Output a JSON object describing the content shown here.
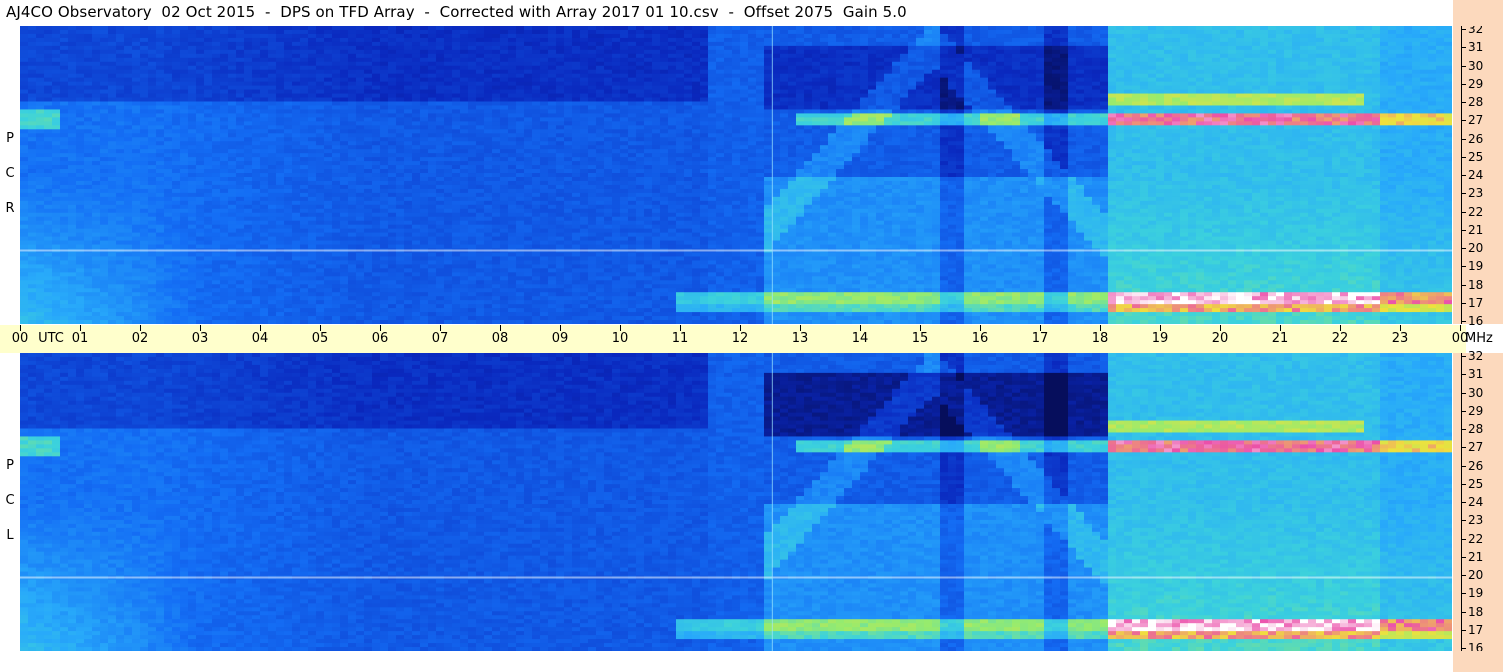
{
  "title": "AJ4CO Observatory  02 Oct 2015  -  DPS on TFD Array  -  Corrected with Array 2017 01 10.csv  -  Offset 2075  Gain 5.0",
  "panels": {
    "top": {
      "label_letters": [
        "R",
        "C",
        "P"
      ]
    },
    "bottom": {
      "label_letters": [
        "L",
        "C",
        "P"
      ]
    }
  },
  "time_axis": {
    "labels": [
      "00",
      "01",
      "02",
      "03",
      "04",
      "05",
      "06",
      "07",
      "08",
      "09",
      "10",
      "11",
      "12",
      "13",
      "14",
      "15",
      "16",
      "17",
      "18",
      "19",
      "20",
      "21",
      "22",
      "23",
      "00"
    ],
    "unit": "UTC"
  },
  "freq_axis": {
    "ticks": [
      "32",
      "31",
      "30",
      "29",
      "28",
      "27",
      "26",
      "25",
      "24",
      "23",
      "22",
      "21",
      "20",
      "19",
      "18",
      "17",
      "16"
    ],
    "unit": "MHz"
  },
  "colors": {
    "title_bg": "#ffffff",
    "time_axis_bg": "#ffffcc",
    "freq_axis_bg": "#fcd9bd",
    "colormap_low": "#0a1e6e",
    "colormap_mid": "#1a64f0",
    "colormap_high": "#ffffff"
  },
  "chart_data": {
    "type": "heatmap",
    "title": "AJ4CO Observatory  02 Oct 2015  -  DPS on TFD Array  -  Corrected with Array 2017 01 10.csv  -  Offset 2075  Gain 5.0",
    "panels": [
      "RCP",
      "LCP"
    ],
    "x_range_utc_hours": [
      0,
      24
    ],
    "y_range_mhz": [
      16,
      32
    ],
    "strong_bands_mhz": [
      27,
      17.5,
      28
    ],
    "night_low_noise_utc": [
      12.5,
      18
    ]
  }
}
